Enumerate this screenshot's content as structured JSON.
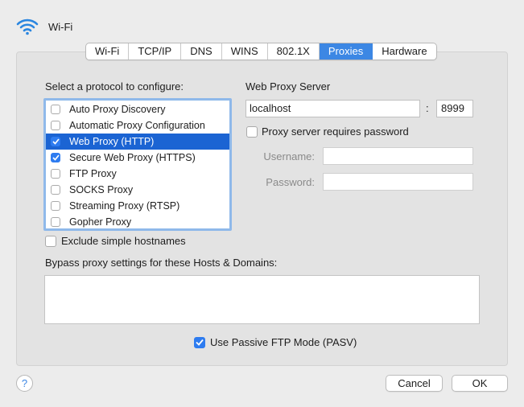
{
  "header": {
    "title": "Wi-Fi",
    "icon": "wifi-icon"
  },
  "tabs": [
    {
      "label": "Wi-Fi",
      "active": false
    },
    {
      "label": "TCP/IP",
      "active": false
    },
    {
      "label": "DNS",
      "active": false
    },
    {
      "label": "WINS",
      "active": false
    },
    {
      "label": "802.1X",
      "active": false
    },
    {
      "label": "Proxies",
      "active": true
    },
    {
      "label": "Hardware",
      "active": false
    }
  ],
  "protocols": {
    "label": "Select a protocol to configure:",
    "items": [
      {
        "label": "Auto Proxy Discovery",
        "checked": false,
        "selected": false
      },
      {
        "label": "Automatic Proxy Configuration",
        "checked": false,
        "selected": false
      },
      {
        "label": "Web Proxy (HTTP)",
        "checked": true,
        "selected": true
      },
      {
        "label": "Secure Web Proxy (HTTPS)",
        "checked": true,
        "selected": false
      },
      {
        "label": "FTP Proxy",
        "checked": false,
        "selected": false
      },
      {
        "label": "SOCKS Proxy",
        "checked": false,
        "selected": false
      },
      {
        "label": "Streaming Proxy (RTSP)",
        "checked": false,
        "selected": false
      },
      {
        "label": "Gopher Proxy",
        "checked": false,
        "selected": false
      }
    ]
  },
  "server": {
    "label": "Web Proxy Server",
    "host": "localhost",
    "separator": ":",
    "port": "8999",
    "requires_password_label": "Proxy server requires password",
    "requires_password": false,
    "username_label": "Username:",
    "username": "",
    "password_label": "Password:",
    "password": ""
  },
  "exclude_simple": {
    "label": "Exclude simple hostnames",
    "checked": false
  },
  "bypass": {
    "label": "Bypass proxy settings for these Hosts & Domains:",
    "value": ""
  },
  "pasv": {
    "label": "Use Passive FTP Mode (PASV)",
    "checked": true
  },
  "footer": {
    "help": "?",
    "cancel": "Cancel",
    "ok": "OK"
  },
  "colors": {
    "accent": "#3c87e4",
    "selection": "#1b64d3",
    "checkbox": "#2e7cf0"
  }
}
